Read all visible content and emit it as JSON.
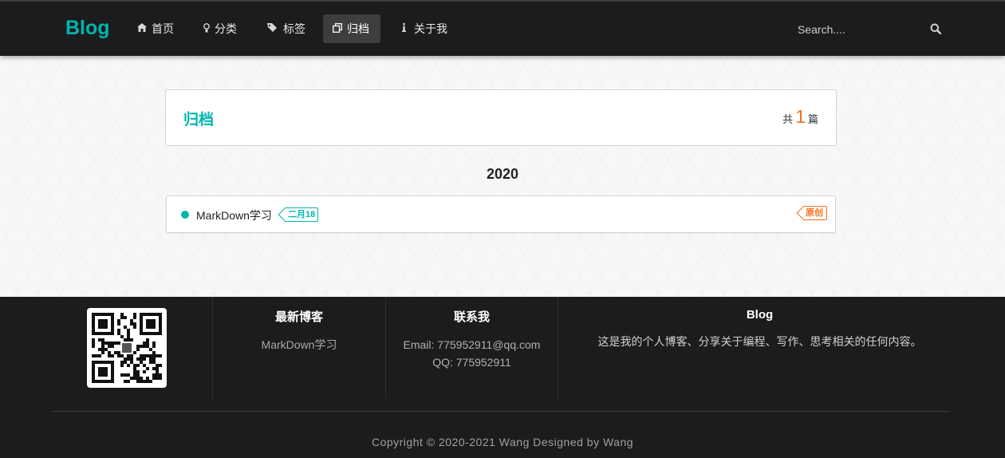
{
  "nav": {
    "logo": "Blog",
    "items": [
      {
        "label": "首页",
        "icon": "home-icon"
      },
      {
        "label": "分类",
        "icon": "idea-icon"
      },
      {
        "label": "标签",
        "icon": "tags-icon"
      },
      {
        "label": "归档",
        "icon": "clone-icon",
        "active": true
      },
      {
        "label": "关于我",
        "icon": "info-icon"
      }
    ],
    "search_placeholder": "Search...."
  },
  "archive": {
    "title": "归档",
    "count_prefix": "共",
    "count": "1",
    "count_suffix": "篇"
  },
  "year": "2020",
  "posts": [
    {
      "title": "MarkDown学习",
      "date": "二月18",
      "type": "原创"
    }
  ],
  "footer": {
    "latest": {
      "title": "最新博客",
      "items": [
        "MarkDown学习"
      ]
    },
    "contact": {
      "title": "联系我",
      "email": "Email: 775952911@qq.com",
      "qq": "QQ: 775952911"
    },
    "about": {
      "title": "Blog",
      "text": "这是我的个人博客、分享关于编程、写作、思考相关的任何内容。"
    },
    "copyright": "Copyright © 2020-2021 Wang Designed by Wang"
  },
  "colors": {
    "accent": "#00b5ad",
    "orange": "#f2711c",
    "dark": "#1b1c1d"
  }
}
